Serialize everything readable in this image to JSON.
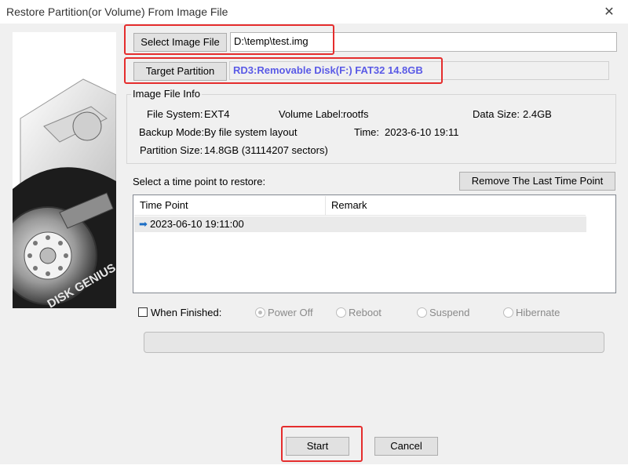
{
  "window": {
    "title": "Restore Partition(or Volume) From Image File",
    "close_glyph": "✕"
  },
  "image_file": {
    "button": "Select Image File",
    "path": "D:\\temp\\test.img"
  },
  "target": {
    "button": "Target Partition",
    "value": "RD3:Removable Disk(F:) FAT32 14.8GB",
    "value_color": "#5a5ae6"
  },
  "info": {
    "group_title": "Image File Info",
    "fs_label": "File System:",
    "fs_value": "EXT4",
    "vol_label": "Volume Label:",
    "vol_value": "rootfs",
    "datasize_label": "Data Size:",
    "datasize_value": "2.4GB",
    "backup_label": "Backup Mode:",
    "backup_value": "By file system layout",
    "time_label": "Time:",
    "time_value": "2023-6-10 19:11",
    "psize_label": "Partition Size:",
    "psize_value": "14.8GB  (31114207 sectors)"
  },
  "timepoints": {
    "prompt": "Select a time point to restore:",
    "remove_button": "Remove The Last Time Point",
    "columns": [
      "Time Point",
      "Remark"
    ],
    "rows": [
      {
        "time": "2023-06-10 19:11:00",
        "remark": ""
      }
    ]
  },
  "finish": {
    "checkbox_label": "When Finished:",
    "checked": false,
    "options": [
      "Power Off",
      "Reboot",
      "Suspend",
      "Hibernate"
    ],
    "selected": "Power Off"
  },
  "progress": {
    "value": 0
  },
  "actions": {
    "start": "Start",
    "cancel": "Cancel"
  },
  "watermark": {
    "brand": "DISK GENIUS"
  },
  "colors": {
    "highlight_border": "#e52d2d",
    "dialog_bg": "#f0f0f0"
  }
}
